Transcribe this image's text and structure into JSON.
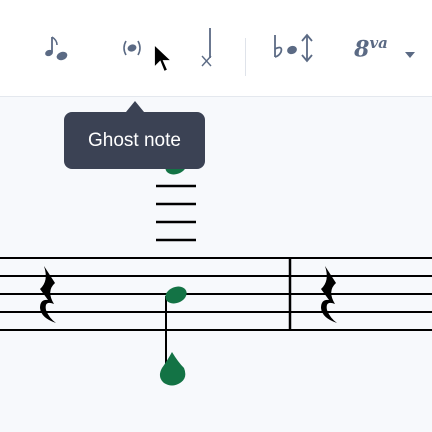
{
  "toolbar": {
    "buttons": [
      {
        "name": "grace-note-icon"
      },
      {
        "name": "ghost-note-icon"
      },
      {
        "name": "cross-note-icon"
      },
      {
        "name": "flat-enharmonic-icon"
      },
      {
        "name": "ottava-icon",
        "label_main": "8",
        "label_sup": "va"
      }
    ]
  },
  "tooltip": {
    "text": "Ghost note"
  },
  "colors": {
    "note_accent": "#137345",
    "icon": "#5b6a84",
    "tooltip_bg": "#3b4254"
  }
}
